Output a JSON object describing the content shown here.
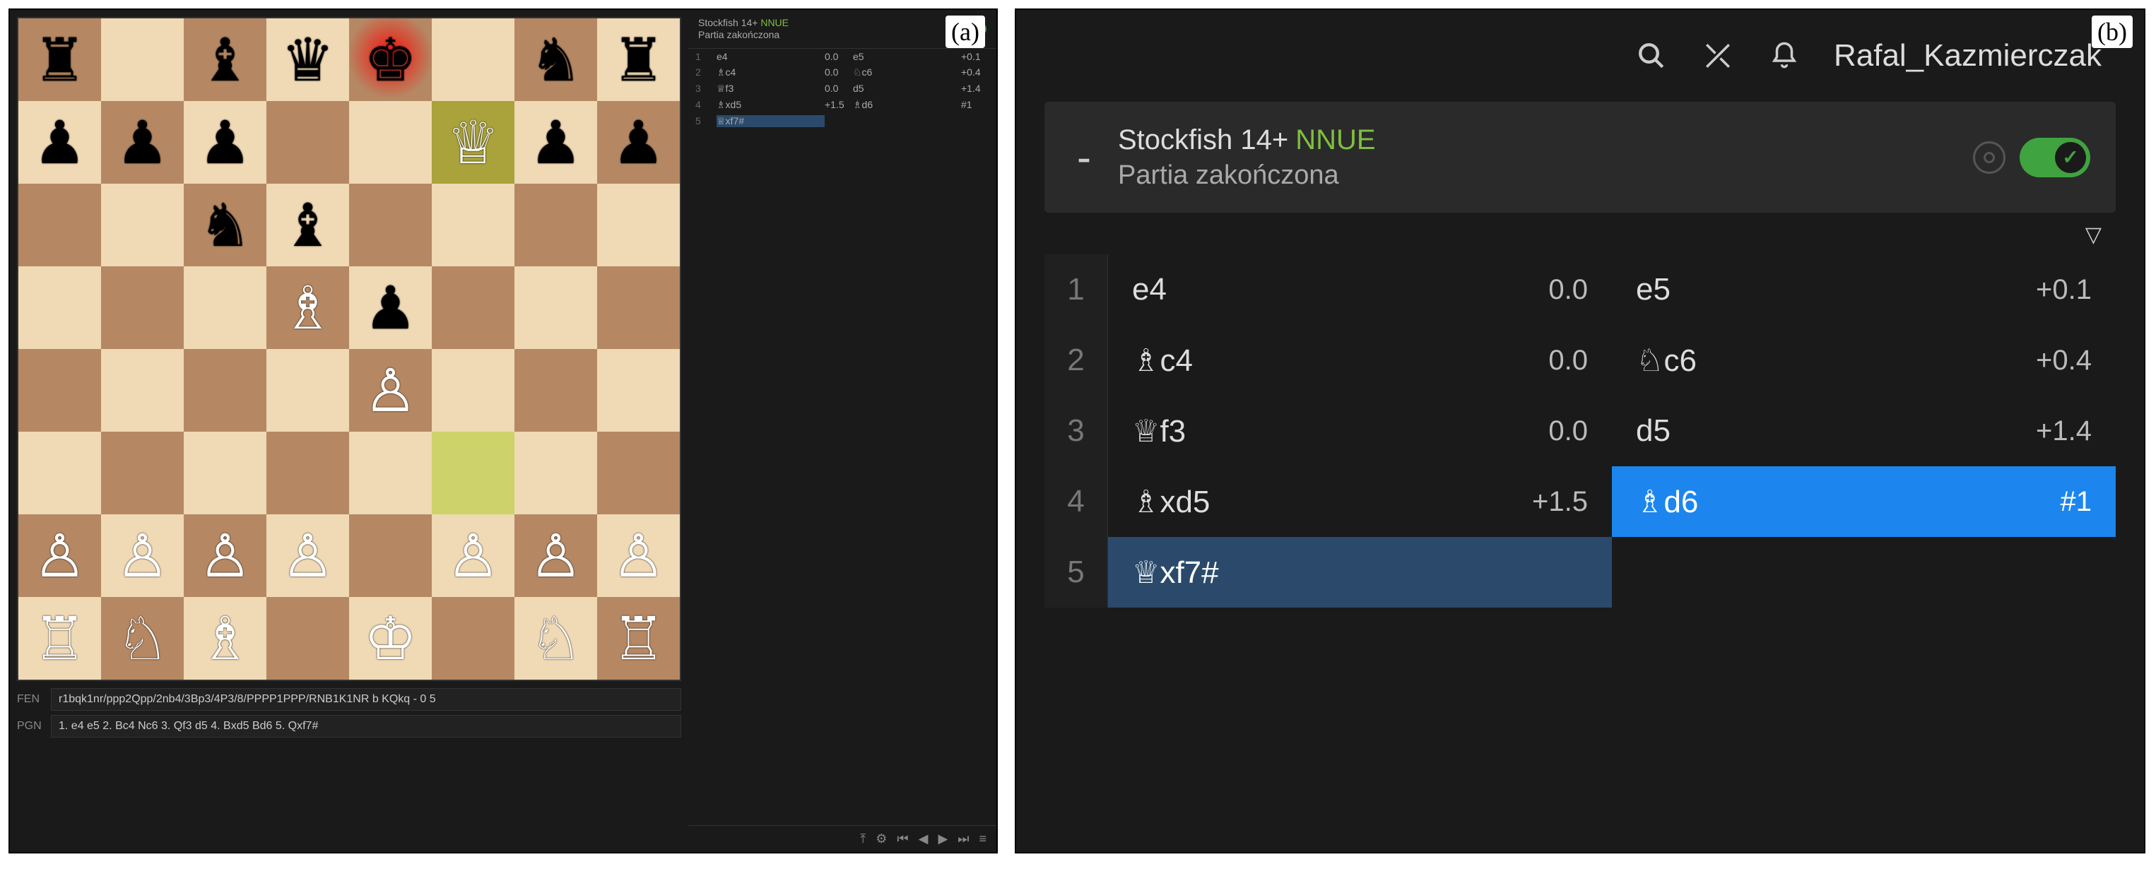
{
  "labels": {
    "a": "(a)",
    "b": "(b)"
  },
  "board": {
    "light": "#f0d9b5",
    "dark": "#b58863",
    "highlight_from": "f3",
    "highlight_to": "f7",
    "check_square": "e8",
    "position": {
      "a8": "br",
      "c8": "bb",
      "d8": "bq",
      "e8": "bk",
      "g8": "bn",
      "h8": "br",
      "a7": "bp",
      "b7": "bp",
      "c7": "bp",
      "f7": "wq",
      "g7": "bp",
      "h7": "bp",
      "c6": "bn",
      "d6": "bb",
      "d5": "wb",
      "e5": "bp",
      "e4": "wp",
      "a2": "wp",
      "b2": "wp",
      "c2": "wp",
      "d2": "wp",
      "f2": "wp",
      "g2": "wp",
      "h2": "wp",
      "a1": "wr",
      "b1": "wn",
      "c1": "wb",
      "e1": "wk",
      "g1": "wn",
      "h1": "wr"
    }
  },
  "panel_a": {
    "engine_mini": {
      "name": "Stockfish 14+",
      "tag": "NNUE",
      "status": "Partia zakończona"
    },
    "moves": [
      {
        "n": "1",
        "w": "e4",
        "we": "0.0",
        "b": "e5",
        "be": "+0.1"
      },
      {
        "n": "2",
        "w": "♗c4",
        "we": "0.0",
        "b": "♘c6",
        "be": "+0.4"
      },
      {
        "n": "3",
        "w": "♕f3",
        "we": "0.0",
        "b": "d5",
        "be": "+1.4"
      },
      {
        "n": "4",
        "w": "♗xd5",
        "we": "+1.5",
        "b": "♗d6",
        "be": "#1"
      },
      {
        "n": "5",
        "w": "♕xf7#",
        "we": "",
        "b": "",
        "be": ""
      }
    ],
    "current": {
      "row": 5,
      "side": "w"
    },
    "fen_label": "FEN",
    "fen": "r1bqk1nr/ppp2Qpp/2nb4/3Bp3/4P3/8/PPPP1PPP/RNB1K1NR b KQkq - 0 5",
    "pgn_label": "PGN",
    "pgn": "1. e4 e5 2. Bc4 Nc6 3. Qf3 d5 4. Bxd5 Bd6 5. Qxf7#",
    "controls": [
      "⤒",
      "⚙",
      "⏮",
      "◀",
      "▶",
      "⏭",
      "≡"
    ]
  },
  "panel_b": {
    "top_icons": [
      "search",
      "swords",
      "bell"
    ],
    "username": "Rafal_Kazmierczak",
    "engine": {
      "name": "Stockfish 14+",
      "tag": "NNUE",
      "status": "Partia zakończona",
      "enabled": true
    },
    "moves": [
      {
        "n": "1",
        "w": "e4",
        "we": "0.0",
        "b": "e5",
        "be": "+0.1"
      },
      {
        "n": "2",
        "w": "♗c4",
        "we": "0.0",
        "b": "♘c6",
        "be": "+0.4"
      },
      {
        "n": "3",
        "w": "♕f3",
        "we": "0.0",
        "b": "d5",
        "be": "+1.4"
      },
      {
        "n": "4",
        "w": "♗xd5",
        "we": "+1.5",
        "b": "♗d6",
        "be": "#1"
      },
      {
        "n": "5",
        "w": "♕xf7#",
        "we": "",
        "b": "",
        "be": ""
      }
    ],
    "highlight": {
      "row": 4,
      "side": "b"
    },
    "last_played": {
      "row": 5,
      "side": "w"
    }
  },
  "glyphs": {
    "wk": "♔",
    "wq": "♕",
    "wr": "♖",
    "wb": "♗",
    "wn": "♘",
    "wp": "♙",
    "bk": "♚",
    "bq": "♛",
    "br": "♜",
    "bb": "♝",
    "bn": "♞",
    "bp": "♟"
  }
}
